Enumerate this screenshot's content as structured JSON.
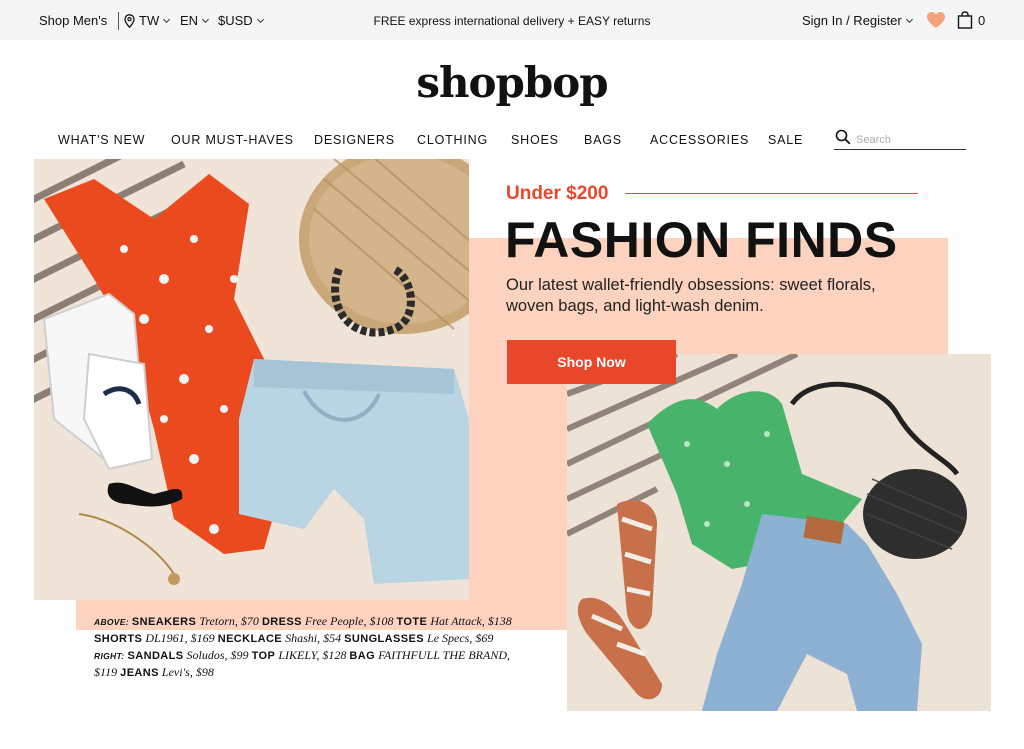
{
  "topbar": {
    "shop_mens": "Shop Men's",
    "country": "TW",
    "language": "EN",
    "currency": "$USD",
    "promo": "FREE express international delivery + EASY returns",
    "sign_in": "Sign In / Register",
    "bag_count": "0"
  },
  "brand": {
    "logo": "shopbop"
  },
  "nav": {
    "items": [
      "WHAT'S NEW",
      "OUR MUST-HAVES",
      "DESIGNERS",
      "CLOTHING",
      "SHOES",
      "BAGS",
      "ACCESSORIES",
      "SALE"
    ],
    "search_placeholder": "Search"
  },
  "hero": {
    "eyebrow": "Under $200",
    "headline": "FASHION FINDS",
    "subcopy": "Our latest wallet-friendly obsessions: sweet florals, woven bags, and light-wash denim.",
    "cta": "Shop Now"
  },
  "credits": {
    "above_label": "ABOVE:",
    "right_label": "RIGHT:",
    "items": [
      {
        "name": "SNEAKERS",
        "detail": "Tretorn, $70"
      },
      {
        "name": "DRESS",
        "detail": "Free People, $108"
      },
      {
        "name": "TOTE",
        "detail": "Hat Attack, $138"
      },
      {
        "name": "SHORTS",
        "detail": "DL1961, $169"
      },
      {
        "name": "NECKLACE",
        "detail": "Shashi, $54"
      },
      {
        "name": "SUNGLASSES",
        "detail": "Le Specs, $69"
      },
      {
        "name": "SANDALS",
        "detail": "Soludos, $99"
      },
      {
        "name": "TOP",
        "detail": "LIKELY, $128"
      },
      {
        "name": "BAG",
        "detail": "FAITHFULL THE BRAND, $119"
      },
      {
        "name": "JEANS",
        "detail": "Levi's, $98"
      }
    ]
  },
  "colors": {
    "accent": "#e8472a",
    "salmon": "#fdd3c0",
    "heart": "#f4a37a",
    "topbar_bg": "#f5f5f5"
  },
  "icons": [
    "location-pin-icon",
    "chevron-down-icon",
    "heart-icon",
    "shopping-bag-icon",
    "search-icon"
  ]
}
